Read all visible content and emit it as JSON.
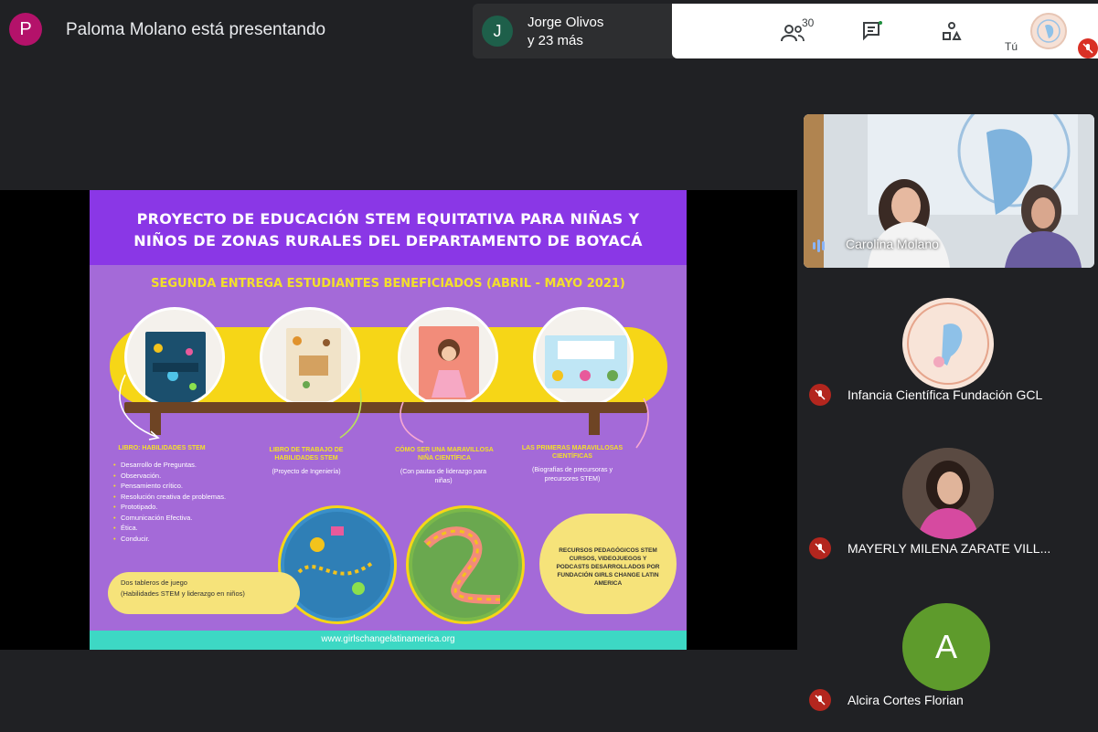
{
  "header": {
    "presenter_initial": "P",
    "presenter_text": "Paloma Molano está presentando",
    "participants_initial": "J",
    "participants_line1": "Jorge Olivos",
    "participants_line2": "y 23 más",
    "people_count": "30",
    "self_label": "Tú"
  },
  "slide": {
    "title_line1": "PROYECTO DE EDUCACIÓN STEM EQUITATIVA PARA NIÑAS Y",
    "title_line2": "NIÑOS DE ZONAS RURALES DEL DEPARTAMENTO DE BOYACÁ",
    "subtitle": "SEGUNDA ENTREGA ESTUDIANTES BENEFICIADOS (ABRIL - MAYO 2021)",
    "columns": [
      {
        "title": "LIBRO: HABILIDADES STEM",
        "text": ""
      },
      {
        "title": "LIBRO DE TRABAJO DE HABILIDADES STEM",
        "text": "(Proyecto de Ingeniería)"
      },
      {
        "title": "CÓMO SER UNA MARAVILLOSA NIÑA CIENTÍFICA",
        "text": "(Con pautas de liderazgo para niñas)"
      },
      {
        "title": "LAS PRIMERAS MARAVILLOSAS CIENTÍFICAS",
        "text": "(Biografías de precursoras y precursores STEM)"
      }
    ],
    "skills": [
      "Desarrollo de Preguntas.",
      "Observación.",
      "Pensamiento crítico.",
      "Resolución creativa de problemas.",
      "Prototipado.",
      "Comunicación Efectiva.",
      "Ética.",
      "Conducir."
    ],
    "callout_left_line1": "Dos tableros de juego",
    "callout_left_line2": "(Habilidades STEM y liderazgo en niños)",
    "callout_right": "Recursos pedagógicos STEM cursos, videojuegos y podcasts desarrollados por fundación Girls Change Latin America",
    "url": "www.girlschangelatinamerica.org"
  },
  "tiles": {
    "video_name": "Carolina Molano",
    "tile1_name": "Infancia Científica Fundación GCL",
    "tile2_name": "MAYERLY MILENA ZARATE VILL...",
    "tile3_initial": "A",
    "tile3_name": "Alcira Cortes Florian"
  },
  "colors": {
    "presenter_avatar": "#b4126a",
    "participants_avatar": "#1e5f4a",
    "letter_avatar": "#5e9b2c",
    "mute_red": "#b3261e",
    "slide_purple": "#8a37e6",
    "slide_yellow": "#f6d617",
    "slide_teal": "#3dd8c4"
  },
  "icons": [
    "people-icon",
    "chat-icon",
    "activities-icon",
    "mic-off-icon",
    "audio-level-icon"
  ]
}
